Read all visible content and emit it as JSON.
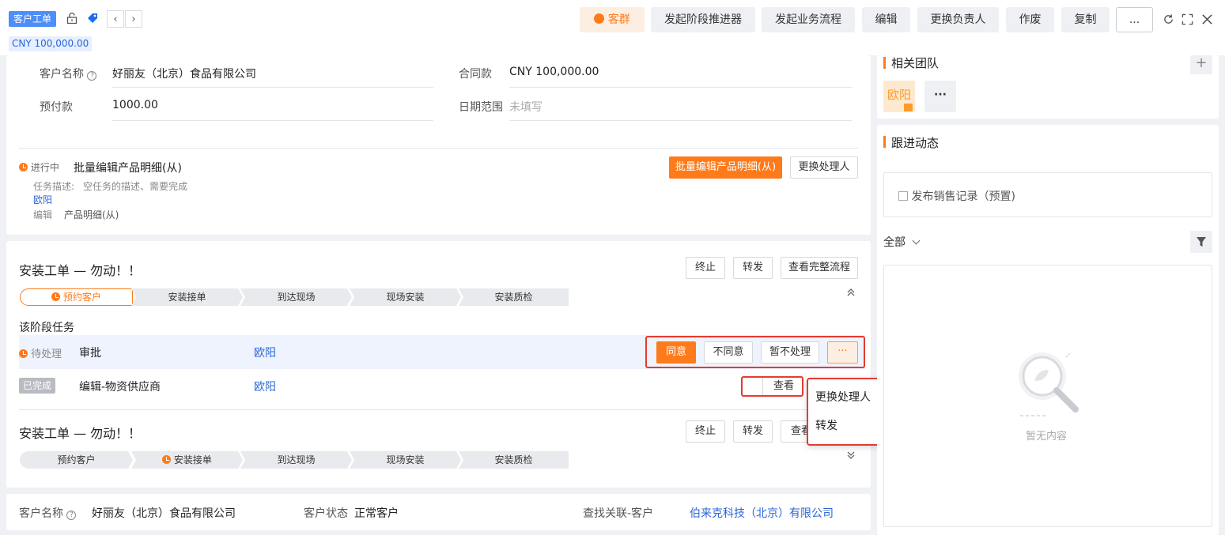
{
  "header": {
    "title_tag": "客户工单",
    "amount_tag": "CNY 100,000.00",
    "buttons": {
      "kequn": "客群",
      "stage_advance": "发起阶段推进器",
      "business_flow": "发起业务流程",
      "edit": "编辑",
      "change_owner": "更换负责人",
      "void": "作废",
      "copy": "复制",
      "more": "..."
    }
  },
  "form": {
    "customer_name_label": "客户名称",
    "customer_name_value": "好丽友（北京）食品有限公司",
    "contract_label": "合同款",
    "contract_value": "CNY 100,000.00",
    "prepay_label": "预付款",
    "prepay_value": "1000.00",
    "date_range_label": "日期范围",
    "date_range_placeholder": "未填写"
  },
  "task_block": {
    "status": "进行中",
    "title": "批量编辑产品明细(从)",
    "desc_label": "任务描述:",
    "desc_value": "空任务的描述、需要完成",
    "assignee": "欧阳",
    "edit_label": "编辑",
    "edit_value": "产品明细(从)",
    "primary_btn": "批量编辑产品明细(从)",
    "change_handler_btn": "更换处理人"
  },
  "flow1": {
    "title": "安装工单 — 勿动！！",
    "btn_stop": "终止",
    "btn_forward": "转发",
    "btn_full": "查看完整流程",
    "stages": [
      "预约客户",
      "安装接单",
      "到达现场",
      "现场安装",
      "安装质检"
    ],
    "section_title": "该阶段任务",
    "tasks": [
      {
        "status": "待处理",
        "name": "审批",
        "assignee": "欧阳"
      },
      {
        "status": "已完成",
        "name": "编辑-物资供应商",
        "assignee": "欧阳"
      }
    ],
    "btn_agree": "同意",
    "btn_disagree": "不同意",
    "btn_hold": "暂不处理",
    "btn_more": "···",
    "btn_view_detail": "查看详"
  },
  "dropdown": {
    "items": [
      "更换处理人",
      "转发"
    ]
  },
  "flow2": {
    "title": "安装工单 — 勿动！！",
    "btn_stop": "终止",
    "btn_forward": "转发",
    "btn_full": "查看",
    "stages": [
      "预约客户",
      "安装接单",
      "到达现场",
      "现场安装",
      "安装质检"
    ]
  },
  "bottom": {
    "customer_name_label": "客户名称",
    "customer_name_value": "好丽友（北京）食品有限公司",
    "customer_status_label": "客户状态",
    "customer_status_value": "正常客户",
    "related_label": "查找关联-客户",
    "related_value": "伯来克科技（北京）有限公司"
  },
  "right": {
    "team_title": "相关团队",
    "team_member": "欧阳",
    "team_more": "···",
    "add": "+",
    "follow_title": "跟进动态",
    "publish": "发布销售记录（预置)",
    "filter_label": "全部",
    "empty_text": "暂无内容"
  },
  "colors": {
    "accent_orange": "#ff7a1a",
    "link_blue": "#2a66d6",
    "highlight_red": "#e63b2e"
  }
}
